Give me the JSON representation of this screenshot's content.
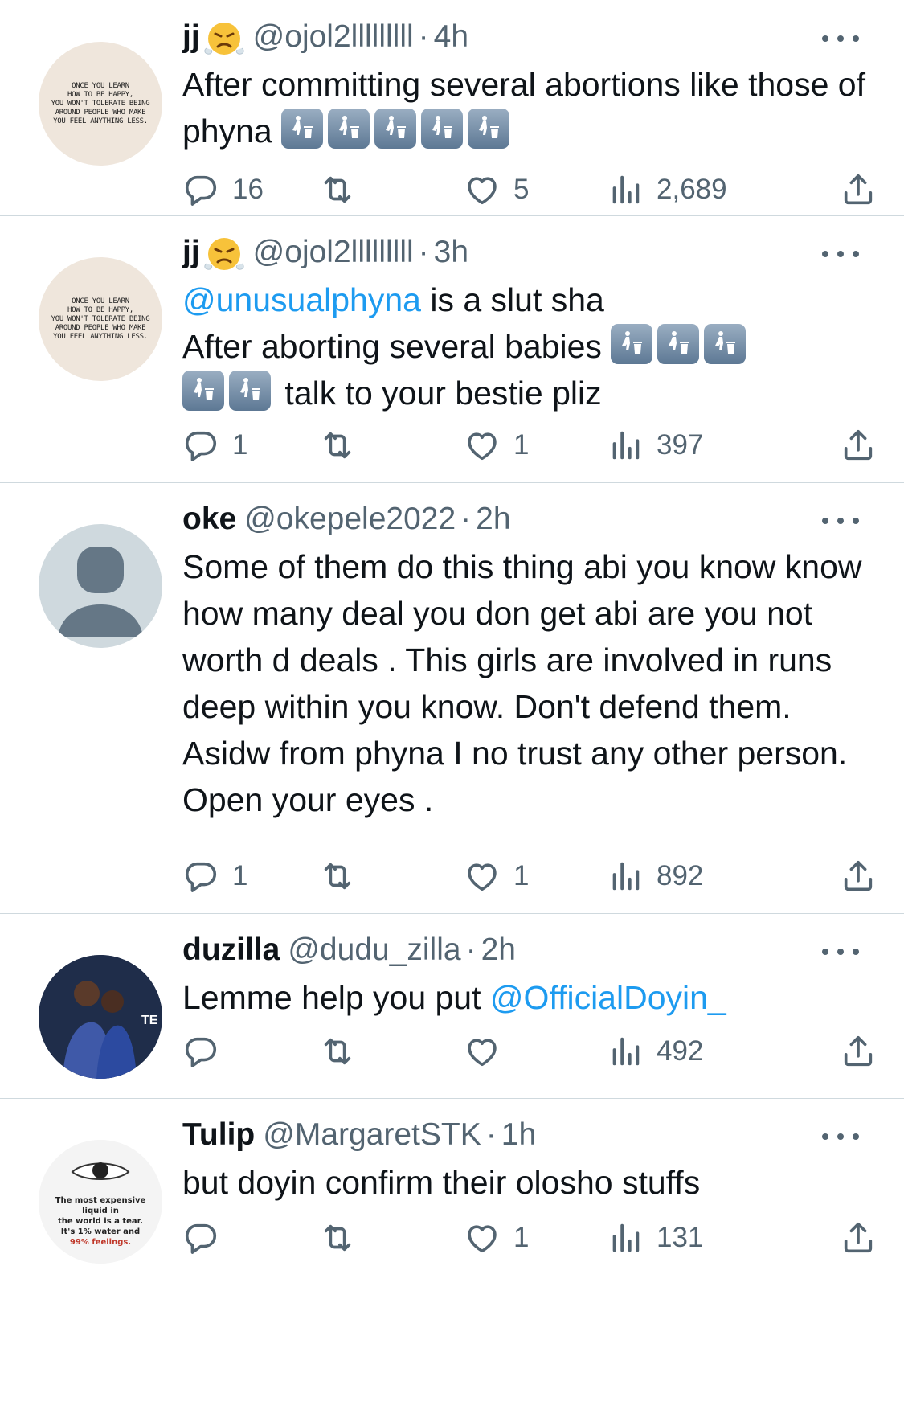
{
  "tweets": [
    {
      "name": "jj",
      "handle": "@ojol2lllllllll",
      "dot": "·",
      "time": "4h",
      "text_plain": "After committing several abortions  like those of phyna",
      "emoji_name": "put-litter-in-its-place-icon",
      "replies": "16",
      "retweets": "",
      "likes": "5",
      "views": "2,689"
    },
    {
      "name": "jj",
      "handle": "@ojol2lllllllll",
      "dot": "·",
      "time": "3h",
      "mention": "@unusualphyna",
      "line1_rest": " is a slut sha",
      "line2": "After aborting several babies ",
      "line3": " talk to your bestie pliz",
      "replies": "1",
      "retweets": "",
      "likes": "1",
      "views": "397"
    },
    {
      "name": "oke",
      "handle": "@okepele2022",
      "dot": "·",
      "time": "2h",
      "text_plain": "Some of them do this thing abi you know know how many deal you don get abi are you not worth d deals . This girls are involved in runs deep within you know. Don't defend them. Asidw from phyna I no trust any other person.  Open your eyes .",
      "replies": "1",
      "retweets": "",
      "likes": "1",
      "views": "892"
    },
    {
      "name": "duzilla",
      "handle": "@dudu_zilla",
      "dot": "·",
      "time": "2h",
      "text_plain": "Lemme help you put ",
      "mention": "@OfficialDoyin_",
      "replies": "",
      "retweets": "",
      "likes": "",
      "views": "492"
    },
    {
      "name": "Tulip",
      "handle": "@MargaretSTK",
      "dot": "·",
      "time": "1h",
      "text_plain": "but doyin confirm their olosho stuffs",
      "replies": "",
      "retweets": "",
      "likes": "1",
      "views": "131"
    }
  ],
  "avatars": {
    "quote_text": [
      "ONCE YOU LEARN",
      "HOW TO BE HAPPY,",
      "YOU WON'T TOLERATE BEING",
      "AROUND PEOPLE WHO MAKE",
      "YOU FEEL ANYTHING LESS."
    ],
    "tulip_text": [
      "The most expensive",
      "liquid in",
      "the world is a tear.",
      "It's 1% water and",
      "99% feelings."
    ],
    "duzilla_text": "TE"
  },
  "colors": {
    "text": "#0f1419",
    "secondary": "#536471",
    "link": "#1d9bf0",
    "divider": "#cfd9de"
  }
}
